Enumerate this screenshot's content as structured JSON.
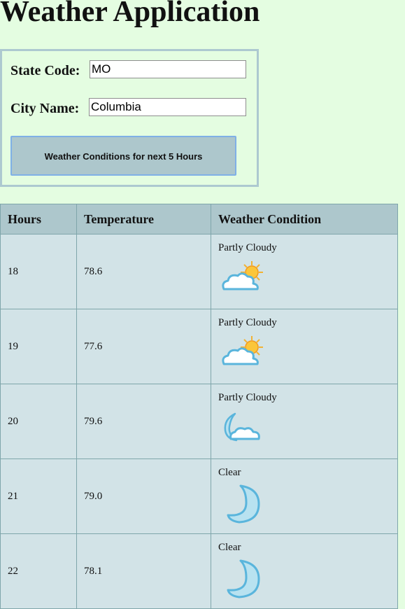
{
  "title": "Weather Application",
  "form": {
    "state_label": "State Code:",
    "state_value": "MO",
    "city_label": "City Name:",
    "city_value": "Columbia",
    "submit_label": "Weather Conditions for next 5 Hours"
  },
  "table": {
    "headers": [
      "Hours",
      "Temperature",
      "Weather Condition"
    ],
    "rows": [
      {
        "hour": "18",
        "temp": "78.6",
        "condition": "Partly Cloudy",
        "icon": "partly-cloudy-day-icon"
      },
      {
        "hour": "19",
        "temp": "77.6",
        "condition": "Partly Cloudy",
        "icon": "partly-cloudy-day-icon"
      },
      {
        "hour": "20",
        "temp": "79.6",
        "condition": "Partly Cloudy",
        "icon": "partly-cloudy-night-icon"
      },
      {
        "hour": "21",
        "temp": "79.0",
        "condition": "Clear",
        "icon": "clear-night-icon"
      },
      {
        "hour": "22",
        "temp": "78.1",
        "condition": "Clear",
        "icon": "clear-night-icon"
      }
    ]
  }
}
